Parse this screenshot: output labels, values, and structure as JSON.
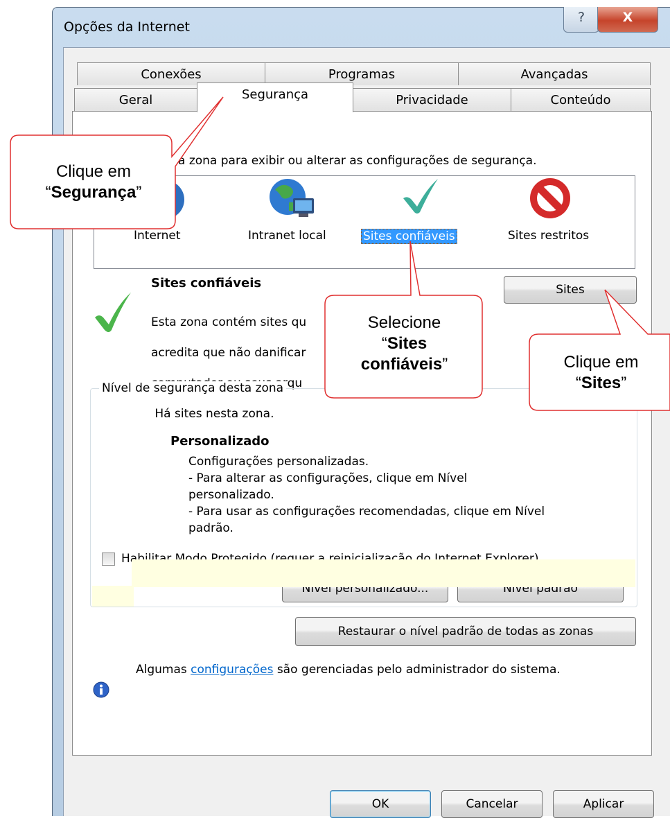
{
  "window": {
    "title": "Opções da Internet",
    "help_glyph": "?",
    "close_glyph": "X"
  },
  "tabs": {
    "row_top": [
      "Conexões",
      "Programas",
      "Avançadas"
    ],
    "row_bottom": [
      "Geral",
      "Segurança",
      "Privacidade",
      "Conteúdo"
    ],
    "selected": "Segurança"
  },
  "security": {
    "instruction": "Selecione uma zona para exibir ou alterar as configurações de segurança.",
    "instruction_visible": "a zona para exibir ou alterar as configurações de segurança.",
    "zones": [
      {
        "label": "Internet",
        "visible_label": "Internet",
        "icon": "globe-icon"
      },
      {
        "label": "Intranet local",
        "icon": "intranet-globe-icon"
      },
      {
        "label": "Sites confiáveis",
        "icon": "checkmark-icon",
        "selected": true
      },
      {
        "label": "Sites restritos",
        "icon": "no-entry-icon"
      }
    ],
    "zone_title": "Sites confiáveis",
    "zone_desc_lines": [
      "Esta zona contém sites qu",
      "acredita que não danificar",
      "computador ou seus arqu",
      " Há sites nesta zona."
    ],
    "sites_button": "Sites",
    "level_group_label": "Nível de segurança desta zona",
    "level_name": "Personalizado",
    "level_desc_lines": [
      "Configurações personalizadas.",
      "- Para alterar as configurações, clique em Nível",
      "personalizado.",
      "- Para usar as configurações recomendadas, clique em Nível",
      "padrão."
    ],
    "protected_mode_label": "Habilitar Modo Protegido (requer a reinicialização do Internet Explorer)",
    "protected_mode_checked": false,
    "custom_level_button": "Nível personalizado...",
    "default_level_button": "Nível padrão",
    "reset_all_button": "Restaurar o nível padrão de todas as zonas",
    "admin_note_prefix": "Algumas ",
    "admin_note_link": "configurações",
    "admin_note_suffix": " são gerenciadas pelo administrador do sistema."
  },
  "footer": {
    "ok": "OK",
    "cancel": "Cancelar",
    "apply": "Aplicar"
  },
  "callouts": {
    "segurança": {
      "line1": "Clique em",
      "open_quote": "“",
      "bold": "Segurança",
      "close_quote": "”"
    },
    "sites_confiaveis": {
      "line1": "Selecione",
      "open_quote": "“",
      "bold1": "Sites",
      "bold2": "confiáveis",
      "close_quote": "”"
    },
    "sites": {
      "line1": "Clique em",
      "open_quote": "“",
      "bold": "Sites",
      "close_quote": "”"
    }
  },
  "colors": {
    "selection": "#3399ff",
    "callout_border": "#e03030",
    "info_bar": "#ffffe1",
    "link": "#0066cc"
  }
}
